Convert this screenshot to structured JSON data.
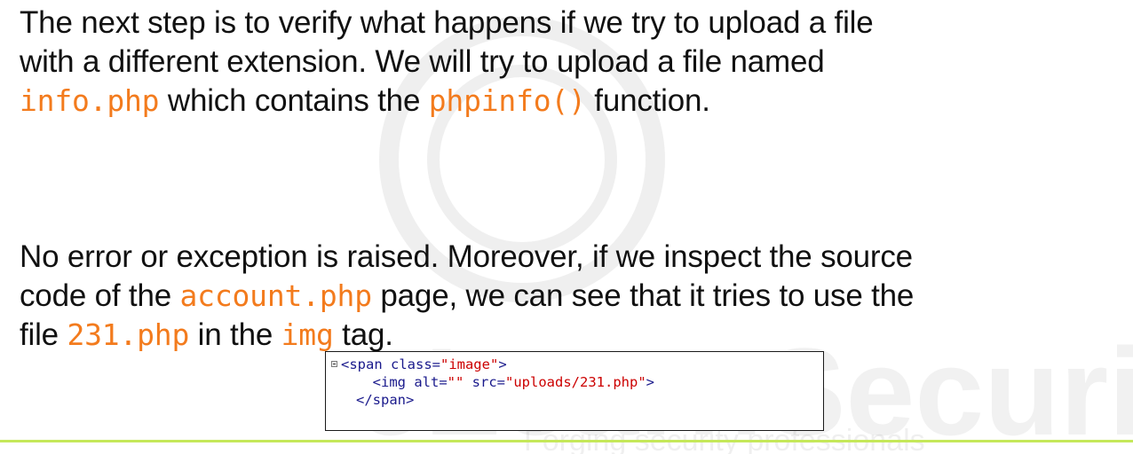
{
  "paragraph1": {
    "line1": "The next step is to verify what happens if we try to upload a file",
    "line2": "with a different extension. We will try to upload a file named",
    "line3_code1": "info.php",
    "line3_mid": " which contains the ",
    "line3_code2": "phpinfo()",
    "line3_end": " function."
  },
  "paragraph2": {
    "line1": "No error or exception is raised. Moreover, if we inspect the source",
    "line2_start": "code of the ",
    "line2_code": "account.php",
    "line2_end": " page, we can see that it tries to use the",
    "line3_start": "file ",
    "line3_code1": "231.php",
    "line3_mid": " in the ",
    "line3_code2": "img",
    "line3_end": " tag."
  },
  "code_snippet": {
    "line1_open": "<span class=",
    "line1_value": "\"image\"",
    "line1_close": ">",
    "line2_open": "<img alt=",
    "line2_alt": "\"\"",
    "line2_src_attr": " src=",
    "line2_src": "\"uploads/231.php\"",
    "line2_close": ">",
    "line3": "</span>"
  },
  "colors": {
    "code_highlight": "#f37b1d",
    "bottom_rule": "#c5e85a",
    "string_literal": "#cc0000",
    "tag_text": "#1a1a8c"
  },
  "watermark": {
    "brand": "eLearnSecurity",
    "tagline": "Forging security professionals"
  }
}
